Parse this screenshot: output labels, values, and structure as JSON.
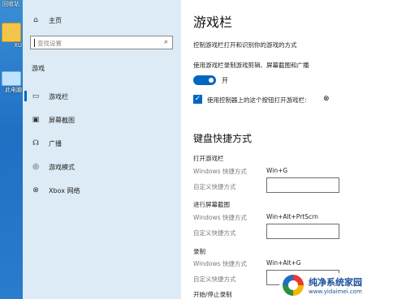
{
  "desktop": {
    "icons": [
      {
        "label": "回收站"
      },
      {
        "label": "XU"
      },
      {
        "label": "此电脑"
      }
    ]
  },
  "nav": {
    "home": "主页",
    "search_placeholder": "查找设置",
    "section": "游戏",
    "items": [
      {
        "label": "游戏栏"
      },
      {
        "label": "屏幕截图"
      },
      {
        "label": "广播"
      },
      {
        "label": "游戏模式"
      },
      {
        "label": "Xbox 网络"
      }
    ]
  },
  "content": {
    "title": "游戏栏",
    "description": "控制游戏栏打开和识别你的游戏的方式",
    "record_label": "使用游戏栏录制游戏剪辑、屏幕截图和广播",
    "toggle_state": "开",
    "checkbox_label": "使用控制器上的这个按钮打开游戏栏:",
    "shortcuts_heading": "键盘快捷方式",
    "shortcuts": [
      {
        "name": "打开游戏栏",
        "windows_label": "Windows 快捷方式",
        "windows_value": "Win+G",
        "custom_label": "自定义快捷方式"
      },
      {
        "name": "进行屏幕截图",
        "windows_label": "Windows 快捷方式",
        "windows_value": "Win+Alt+PrtScrn",
        "custom_label": "自定义快捷方式"
      },
      {
        "name": "录制",
        "windows_label": "Windows 快捷方式",
        "windows_value": "Win+Alt+G",
        "custom_label": "自定义快捷方式"
      }
    ],
    "partial_next": "开始/停止录制"
  },
  "watermark": {
    "name": "纯净系统家园",
    "url": "www.yidaimei.com"
  },
  "colors": {
    "accent": "#0067c0",
    "nav_bg": "#dcebf6"
  }
}
